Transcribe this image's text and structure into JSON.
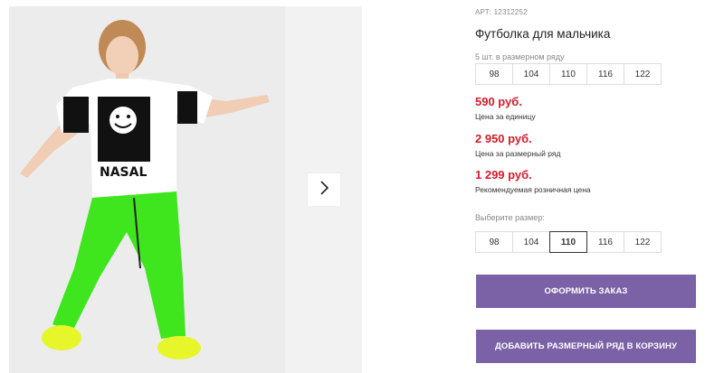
{
  "product": {
    "article": "АРТ: 12312252",
    "title": "Футболка для мальчика"
  },
  "size_row": {
    "label": "5 шт. в размерном ряду",
    "sizes": [
      "98",
      "104",
      "110",
      "116",
      "122"
    ]
  },
  "prices": {
    "unit_price": "590 руб.",
    "unit_label": "Цена за единицу",
    "row_price": "2 950 руб.",
    "row_label": "Цена за размерный ряд",
    "retail_price": "1 299 руб.",
    "retail_label": "Рекомендуемая розничная цена"
  },
  "size_select": {
    "label": "Выберите размер:",
    "sizes": [
      "98",
      "104",
      "110",
      "116",
      "122"
    ],
    "selected": "110"
  },
  "buttons": {
    "order": "ОФОРМИТЬ ЗАКАЗ",
    "add_row": "ДОБАВИТЬ РАЗМЕРНЫЙ РЯД В КОРЗИНУ"
  },
  "colors": {
    "accent": "#7b62a7",
    "price": "#d21c2b"
  },
  "icons": {
    "next": "chevron-right-icon"
  }
}
